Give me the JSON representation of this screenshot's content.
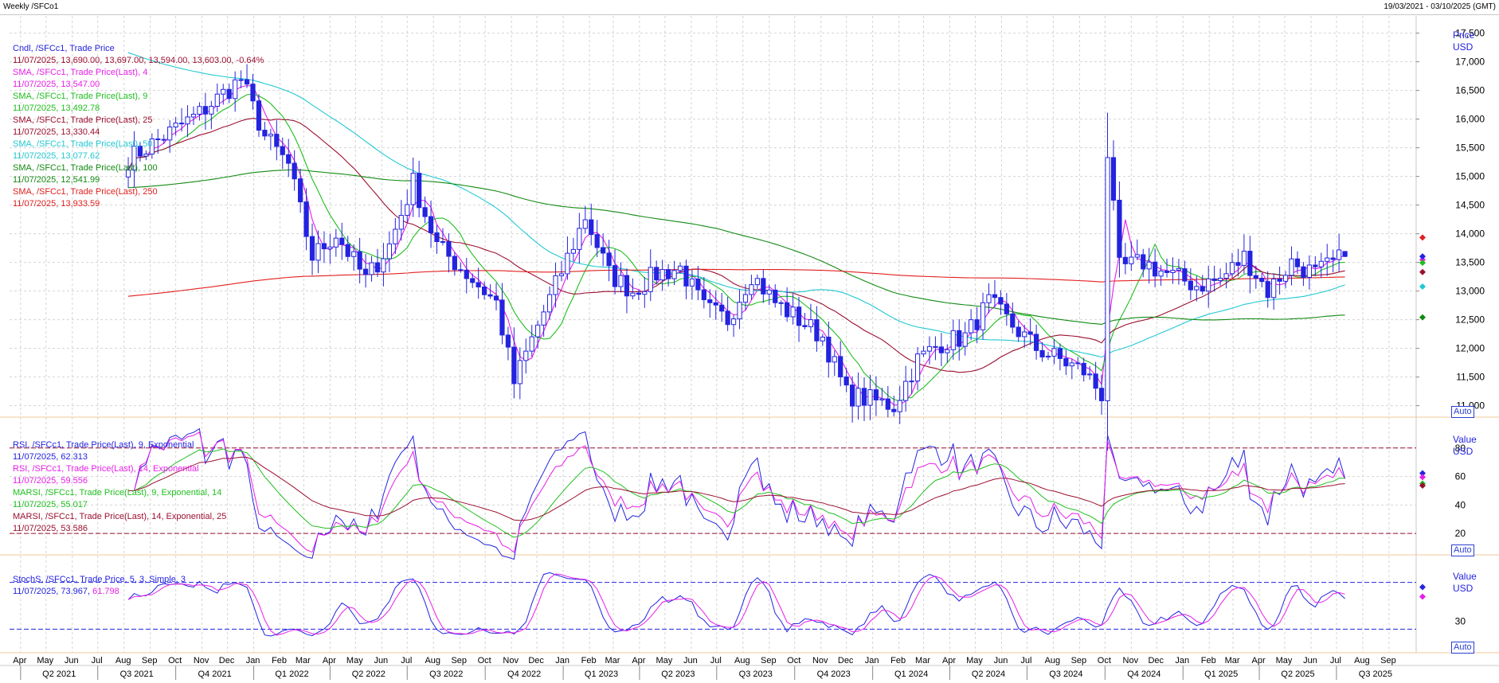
{
  "window": {
    "title": "Weekly /SFCo1",
    "date_range": "19/03/2021 - 03/10/2025 (GMT)"
  },
  "colors": {
    "candle": "#2323e0",
    "sma4": "#e81ee8",
    "sma9": "#1fbf1f",
    "sma25": "#9b1030",
    "sma50": "#20c8d2",
    "sma100": "#138a13",
    "sma250": "#e32020",
    "grid": "#d4d4d4",
    "panel_border": "#f0c89a",
    "axis_text": "#2323e0",
    "legend_blue": "#2323e0",
    "legend_dark": "#8b1a3a",
    "rsi9": "#2323e0",
    "rsi14": "#e81ee8",
    "marsi9": "#1fbf1f",
    "marsi14": "#9b1030",
    "stoch_k": "#2323e0",
    "stoch_d": "#e81ee8"
  },
  "price_panel": {
    "axis_title": "Price",
    "axis_unit": "USD",
    "ticks": [
      "17,500",
      "17,000",
      "16,500",
      "16,000",
      "15,500",
      "15,000",
      "14,500",
      "14,000",
      "13,500",
      "13,000",
      "12,500",
      "12,000",
      "11,500",
      "11,000"
    ],
    "auto_label": "Auto",
    "legend": [
      {
        "label": "Cndl, /SFCc1, Trade Price",
        "values": "11/07/2025, 13,690.00, 13,697.00, 13,594.00, 13,603.00, -0.64%",
        "color": "#2323e0",
        "values_color": "#9b1030"
      },
      {
        "label": "SMA, /SFCc1, Trade Price(Last), 4",
        "values": "11/07/2025, 13,547.00",
        "color": "#e81ee8",
        "values_color": "#e81ee8"
      },
      {
        "label": "SMA, /SFCc1, Trade Price(Last), 9",
        "values": "11/07/2025, 13,492.78",
        "color": "#1fbf1f",
        "values_color": "#1fbf1f"
      },
      {
        "label": "SMA, /SFCc1, Trade Price(Last), 25",
        "values": "11/07/2025, 13,330.44",
        "color": "#9b1030",
        "values_color": "#9b1030"
      },
      {
        "label": "SMA, /SFCc1, Trade Price(Last), 50",
        "values": "11/07/2025, 13,077.62",
        "color": "#20c8d2",
        "values_color": "#20c8d2"
      },
      {
        "label": "SMA, /SFCc1, Trade Price(Last), 100",
        "values": "11/07/2025, 12,541.99",
        "color": "#138a13",
        "values_color": "#138a13"
      },
      {
        "label": "SMA, /SFCc1, Trade Price(Last), 250",
        "values": "11/07/2025, 13,933.59",
        "color": "#e32020",
        "values_color": "#e32020"
      }
    ]
  },
  "rsi_panel": {
    "axis_title": "Value",
    "axis_unit": "USD",
    "ticks": [
      "80",
      "60",
      "40",
      "20"
    ],
    "auto_label": "Auto",
    "legend": [
      {
        "label": "RSI, /SFCc1, Trade Price(Last), 9, Exponential",
        "values": "11/07/2025, 62.313",
        "color": "#2323e0",
        "values_color": "#2323e0"
      },
      {
        "label": "RSI, /SFCc1, Trade Price(Last), 14, Exponential",
        "values": "11/07/2025, 59.556",
        "color": "#e81ee8",
        "values_color": "#e81ee8"
      },
      {
        "label": "MARSI, /SFCc1, Trade Price(Last), 9, Exponential, 14",
        "values": "11/07/2025, 55.017",
        "color": "#1fbf1f",
        "values_color": "#1fbf1f"
      },
      {
        "label": "MARSI, /SFCc1, Trade Price(Last), 14, Exponential, 25",
        "values": "11/07/2025, 53.586",
        "color": "#9b1030",
        "values_color": "#9b1030"
      }
    ]
  },
  "stoch_panel": {
    "axis_title": "Value",
    "axis_unit": "USD",
    "ticks": [
      "30"
    ],
    "auto_label": "Auto",
    "legend": [
      {
        "label": "StochS, /SFCc1, Trade Price,  5, 3, Simple, 3",
        "values_parts": [
          "11/07/2025, ",
          "73.967",
          ", ",
          "61.798"
        ],
        "color": "#2323e0"
      }
    ]
  },
  "time_axis": {
    "months": [
      "Apr",
      "May",
      "Jun",
      "Jul",
      "Aug",
      "Sep",
      "Oct",
      "Nov",
      "Dec",
      "Jan",
      "Feb",
      "Mar",
      "Apr",
      "May",
      "Jun",
      "Jul",
      "Aug",
      "Sep",
      "Oct",
      "Nov",
      "Dec",
      "Jan",
      "Feb",
      "Mar",
      "Apr",
      "May",
      "Jun",
      "Jul",
      "Aug",
      "Sep",
      "Oct",
      "Nov",
      "Dec",
      "Jan",
      "Feb",
      "Mar",
      "Apr",
      "May",
      "Jun",
      "Jul",
      "Aug",
      "Sep",
      "Oct",
      "Nov",
      "Dec",
      "Jan",
      "Feb",
      "Mar",
      "Apr",
      "May",
      "Jun",
      "Jul",
      "Aug",
      "Sep"
    ],
    "quarters": [
      "Q2 2021",
      "Q3 2021",
      "Q4 2021",
      "Q1 2022",
      "Q2 2022",
      "Q3 2022",
      "Q4 2022",
      "Q1 2023",
      "Q2 2023",
      "Q3 2023",
      "Q4 2023",
      "Q1 2024",
      "Q2 2024",
      "Q3 2024",
      "Q4 2024",
      "Q1 2025",
      "Q2 2025",
      "Q3 2025"
    ]
  },
  "chart_data": {
    "type": "candlestick",
    "title": "Weekly /SFCo1",
    "x_range": [
      "2021-03-19",
      "2025-10-03"
    ],
    "price_ylim": [
      10800,
      17800
    ],
    "anchors": [
      {
        "date": "2021-08-06",
        "price": 15300
      },
      {
        "date": "2021-10-29",
        "price": 16100
      },
      {
        "date": "2021-12-17",
        "price": 16700
      },
      {
        "date": "2022-01-14",
        "price": 15700
      },
      {
        "date": "2022-02-11",
        "price": 15200
      },
      {
        "date": "2022-03-11",
        "price": 13600
      },
      {
        "date": "2022-04-08",
        "price": 14000
      },
      {
        "date": "2022-05-13",
        "price": 13200
      },
      {
        "date": "2022-06-10",
        "price": 13800
      },
      {
        "date": "2022-07-08",
        "price": 14900
      },
      {
        "date": "2022-08-05",
        "price": 13800
      },
      {
        "date": "2022-09-09",
        "price": 13300
      },
      {
        "date": "2022-10-14",
        "price": 12800
      },
      {
        "date": "2022-11-04",
        "price": 11400
      },
      {
        "date": "2022-12-02",
        "price": 12400
      },
      {
        "date": "2022-12-23",
        "price": 13100
      },
      {
        "date": "2023-01-27",
        "price": 14300
      },
      {
        "date": "2023-02-24",
        "price": 13300
      },
      {
        "date": "2023-03-24",
        "price": 13000
      },
      {
        "date": "2023-04-21",
        "price": 13300
      },
      {
        "date": "2023-05-19",
        "price": 13400
      },
      {
        "date": "2023-06-16",
        "price": 12700
      },
      {
        "date": "2023-07-14",
        "price": 12500
      },
      {
        "date": "2023-08-11",
        "price": 13300
      },
      {
        "date": "2023-09-08",
        "price": 12800
      },
      {
        "date": "2023-10-06",
        "price": 12500
      },
      {
        "date": "2023-11-03",
        "price": 12200
      },
      {
        "date": "2023-12-01",
        "price": 11200
      },
      {
        "date": "2023-12-29",
        "price": 11100
      },
      {
        "date": "2024-01-26",
        "price": 11000
      },
      {
        "date": "2024-02-23",
        "price": 11800
      },
      {
        "date": "2024-03-22",
        "price": 12100
      },
      {
        "date": "2024-04-19",
        "price": 12200
      },
      {
        "date": "2024-05-17",
        "price": 12800
      },
      {
        "date": "2024-06-14",
        "price": 12400
      },
      {
        "date": "2024-07-12",
        "price": 12000
      },
      {
        "date": "2024-08-09",
        "price": 11800
      },
      {
        "date": "2024-09-06",
        "price": 11600
      },
      {
        "date": "2024-09-27",
        "price": 11200
      },
      {
        "date": "2024-10-04",
        "price": 15400
      },
      {
        "date": "2024-10-18",
        "price": 13400
      },
      {
        "date": "2024-11-15",
        "price": 13500
      },
      {
        "date": "2024-12-13",
        "price": 13300
      },
      {
        "date": "2025-01-17",
        "price": 13100
      },
      {
        "date": "2025-02-14",
        "price": 13200
      },
      {
        "date": "2025-03-14",
        "price": 13600
      },
      {
        "date": "2025-04-11",
        "price": 13000
      },
      {
        "date": "2025-05-09",
        "price": 13500
      },
      {
        "date": "2025-06-06",
        "price": 13300
      },
      {
        "date": "2025-07-11",
        "price": 13603
      }
    ],
    "last_candle": {
      "date": "2025-07-11",
      "open": 13690.0,
      "high": 13697.0,
      "low": 13594.0,
      "close": 13603.0,
      "change_pct": -0.64
    },
    "sma_last": {
      "sma4": 13547.0,
      "sma9": 13492.78,
      "sma25": 13330.44,
      "sma50": 13077.62,
      "sma100": 12541.99,
      "sma250": 13933.59
    },
    "rsi_ylim": [
      5,
      100
    ],
    "rsi_levels": [
      80,
      20
    ],
    "rsi_last": {
      "rsi9": 62.313,
      "rsi14": 59.556,
      "marsi9": 55.017,
      "marsi14": 53.586
    },
    "stoch_ylim": [
      0,
      100
    ],
    "stoch_levels": [
      80,
      20
    ],
    "stoch_last": {
      "k": 73.967,
      "d": 61.798
    },
    "grid": true
  }
}
